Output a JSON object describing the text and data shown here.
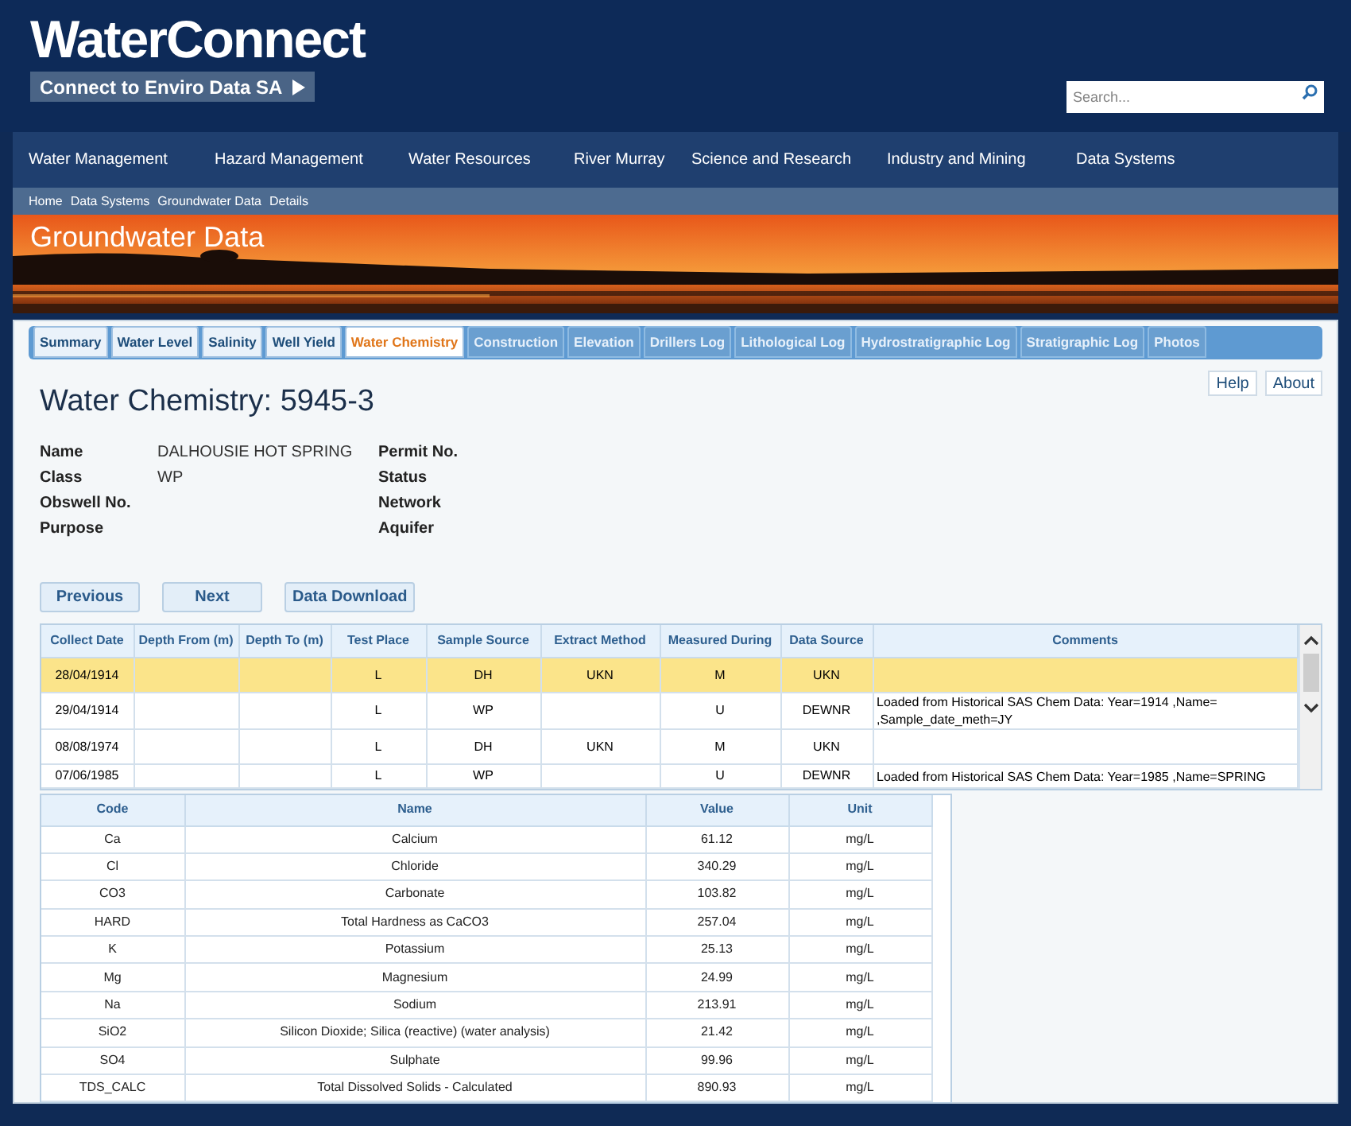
{
  "header": {
    "logo": "WaterConnect",
    "tagline": "Connect to Enviro Data SA",
    "search": {
      "placeholder": "Search..."
    }
  },
  "nav": [
    "Water Management",
    "Hazard Management",
    "Water Resources",
    "River Murray",
    "Science and Research",
    "Industry and Mining",
    "Data Systems"
  ],
  "breadcrumb": [
    "Home",
    "Data Systems",
    "Groundwater Data",
    "Details"
  ],
  "banner": {
    "title": "Groundwater Data"
  },
  "tabs": [
    {
      "label": "Summary",
      "selected": false,
      "disabled": false
    },
    {
      "label": "Water Level",
      "selected": false,
      "disabled": false
    },
    {
      "label": "Salinity",
      "selected": false,
      "disabled": false
    },
    {
      "label": "Well Yield",
      "selected": false,
      "disabled": false
    },
    {
      "label": "Water Chemistry",
      "selected": true,
      "disabled": false
    },
    {
      "label": "Construction",
      "selected": false,
      "disabled": true
    },
    {
      "label": "Elevation",
      "selected": false,
      "disabled": true
    },
    {
      "label": "Drillers Log",
      "selected": false,
      "disabled": true
    },
    {
      "label": "Lithological Log",
      "selected": false,
      "disabled": true
    },
    {
      "label": "Hydrostratigraphic Log",
      "selected": false,
      "disabled": true
    },
    {
      "label": "Stratigraphic Log",
      "selected": false,
      "disabled": true
    },
    {
      "label": "Photos",
      "selected": false,
      "disabled": true
    }
  ],
  "help_links": [
    "Help",
    "About"
  ],
  "title": "Water Chemistry: 5945-3",
  "details": [
    [
      {
        "label": "Name",
        "value": "DALHOUSIE HOT SPRING"
      },
      {
        "label": "Class",
        "value": "WP"
      },
      {
        "label": "Obswell No."
      },
      {
        "label": "Purpose"
      }
    ],
    [
      {
        "label": "Permit No."
      },
      {
        "label": "Status"
      },
      {
        "label": "Network"
      },
      {
        "label": "Aquifer"
      }
    ]
  ],
  "buttons": [
    "Previous",
    "Next",
    "Data Download"
  ],
  "samples": {
    "columns": [
      "Collect Date",
      "Depth From (m)",
      "Depth To (m)",
      "Test Place",
      "Sample Source",
      "Extract Method",
      "Measured During",
      "Data Source",
      "Comments"
    ],
    "rows": [
      {
        "selected": true,
        "cells": [
          "28/04/1914",
          "",
          "",
          "L",
          "DH",
          "UKN",
          "M",
          "UKN",
          ""
        ]
      },
      {
        "selected": false,
        "cells": [
          "29/04/1914",
          "",
          "",
          "L",
          "WP",
          "",
          "U",
          "DEWNR",
          "Loaded from Historical SAS Chem Data: Year=1914 ,Name= ,Sample_date_meth=JY"
        ]
      },
      {
        "selected": false,
        "cells": [
          "08/08/1974",
          "",
          "",
          "L",
          "DH",
          "UKN",
          "M",
          "UKN",
          ""
        ]
      },
      {
        "selected": false,
        "cells": [
          "07/06/1985",
          "",
          "",
          "L",
          "WP",
          "",
          "U",
          "DEWNR",
          "Loaded from Historical SAS Chem Data: Year=1985 ,Name=SPRING"
        ]
      }
    ]
  },
  "analysis": {
    "columns": [
      "Code",
      "Name",
      "Value",
      "Unit"
    ],
    "rows": [
      [
        "Ca",
        "Calcium",
        "61.12",
        "mg/L"
      ],
      [
        "Cl",
        "Chloride",
        "340.29",
        "mg/L"
      ],
      [
        "CO3",
        "Carbonate",
        "103.82",
        "mg/L"
      ],
      [
        "HARD",
        "Total Hardness as CaCO3",
        "257.04",
        "mg/L"
      ],
      [
        "K",
        "Potassium",
        "25.13",
        "mg/L"
      ],
      [
        "Mg",
        "Magnesium",
        "24.99",
        "mg/L"
      ],
      [
        "Na",
        "Sodium",
        "213.91",
        "mg/L"
      ],
      [
        "SiO2",
        "Silicon Dioxide; Silica (reactive) (water analysis)",
        "21.42",
        "mg/L"
      ],
      [
        "SO4",
        "Sulphate",
        "99.96",
        "mg/L"
      ],
      [
        "TDS_CALC",
        "Total Dissolved Solids - Calculated",
        "890.93",
        "mg/L"
      ]
    ]
  }
}
